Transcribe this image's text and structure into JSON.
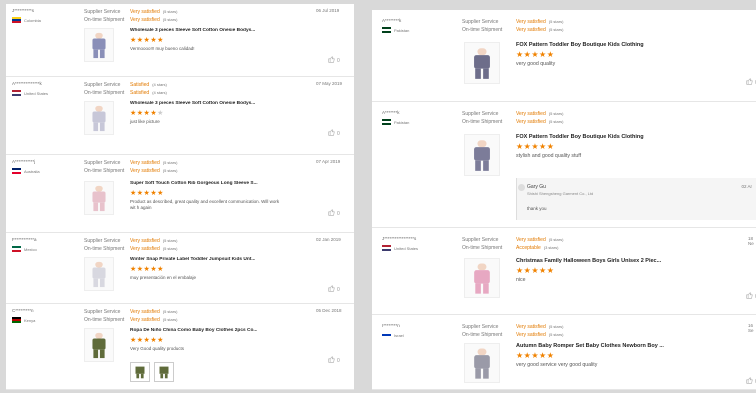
{
  "labels": {
    "service": "Supplier Service",
    "shipment": "On-time Shipment"
  },
  "left_reviews": [
    {
      "buyer": "J**********s",
      "country": "Colombia",
      "flag": [
        "#fcd116",
        "#003893",
        "#ce1126"
      ],
      "service": "Very satisfied",
      "service_note": "(5 stars)",
      "shipment": "Very satisfied",
      "shipment_note": "(5 stars)",
      "title": "Wholesale 3 pieces Sleeve Soft Cotton Onesie Bodys...",
      "stars": 5,
      "comment": "Vermoooo!!! muy bueno calidad!",
      "date": "06 Jul 2019",
      "helpful": "0"
    },
    {
      "buyer": "A**************k",
      "country": "United States",
      "flag": [
        "#b22234",
        "#ffffff",
        "#3c3b6e"
      ],
      "service": "Satisfied",
      "service_note": "(4 stars)",
      "shipment": "Satisfied",
      "shipment_note": "(4 stars)",
      "title": "Wholesale 3 pieces Sleeve Soft Cotton Onesie Bodys...",
      "stars": 4,
      "comment": "just like picture",
      "date": "07 May 2019",
      "helpful": "0"
    },
    {
      "buyer": "A***********j",
      "country": "Australia",
      "flag": [
        "#012169",
        "#ffffff",
        "#e4002b"
      ],
      "service": "Very satisfied",
      "service_note": "(5 stars)",
      "shipment": "Very satisfied",
      "shipment_note": "(5 stars)",
      "title": "Super Soft Touch Cotton Rib Gorgeous Long Sleeve S...",
      "stars": 5,
      "comment": "Product as described, great quality and excellent communication. Will work wit h again",
      "date": "07 Apr 2019",
      "helpful": "0"
    },
    {
      "buyer": "F***********a",
      "country": "Mexico",
      "flag": [
        "#006847",
        "#ffffff",
        "#ce1126"
      ],
      "service": "Very satisfied",
      "service_note": "(5 stars)",
      "shipment": "Very satisfied",
      "shipment_note": "(5 stars)",
      "title": "Winter Snap Private Label Toddler Jumpsuit Kids Unt...",
      "stars": 5,
      "comment": "muy presentación en el embalaje",
      "date": "02 Jan 2019",
      "helpful": "0"
    },
    {
      "buyer": "C*********n",
      "country": "Kenya",
      "flag": [
        "#000000",
        "#bb0000",
        "#006600"
      ],
      "service": "Very satisfied",
      "service_note": "(5 stars)",
      "shipment": "Very satisfied",
      "shipment_note": "(5 stars)",
      "title": "Ropa De Niño China Como Baby Boy Clothes 2pcs Co...",
      "stars": 5,
      "comment": "Very Good quality products",
      "date": "05 Dec 2018",
      "helpful": "0"
    }
  ],
  "right_reviews": [
    {
      "buyer": "A********k",
      "country": "Pakistan",
      "flag": [
        "#01411c",
        "#ffffff",
        "#01411c"
      ],
      "service": "Very satisfied",
      "service_note": "(5 stars)",
      "shipment": "Very satisfied",
      "shipment_note": "(5 stars)",
      "title": "FOX Pattern Toddler Boy Boutique Kids Clothing",
      "stars": 5,
      "comment": "very good quality",
      "date": "",
      "helpful": "0"
    },
    {
      "buyer": "A*******k",
      "country": "Pakistan",
      "flag": [
        "#01411c",
        "#ffffff",
        "#01411c"
      ],
      "service": "Very satisfied",
      "service_note": "(5 stars)",
      "shipment": "Very satisfied",
      "shipment_note": "(5 stars)",
      "title": "FOX Pattern Toddler Boy Boutique Kids Clothing",
      "stars": 5,
      "comment": "stylish and good quality stuff",
      "date": "",
      "helpful": ""
    },
    {
      "buyer": "J*****************s",
      "country": "United States",
      "flag": [
        "#b22234",
        "#ffffff",
        "#3c3b6e"
      ],
      "service": "Very satisfied",
      "service_note": "(5 stars)",
      "shipment": "Acceptable",
      "shipment_note": "(3 stars)",
      "title": "Christmas Family Halloween Boys Girls Unisex 2 Piec...",
      "stars": 5,
      "comment": "nice",
      "date": "18 Ne",
      "helpful": "0"
    },
    {
      "buyer": "I********n",
      "country": "Israel",
      "flag": [
        "#ffffff",
        "#0038b8",
        "#ffffff"
      ],
      "service": "Very satisfied",
      "service_note": "(5 stars)",
      "shipment": "Very satisfied",
      "shipment_note": "(5 stars)",
      "title": "Autumn Baby Romper Set Baby Clothes Newborn Boy ...",
      "stars": 5,
      "comment": "very good service very good quality",
      "date": "16 Se",
      "helpful": "0"
    }
  ],
  "reply": {
    "name": "Gary Gu",
    "company": "Shishi Shengsheng Garment Co., Ltd",
    "text": "thank you",
    "date": "02 Ar"
  },
  "icons": {
    "thumb": "thumbs-up-icon",
    "star": "star-icon"
  }
}
